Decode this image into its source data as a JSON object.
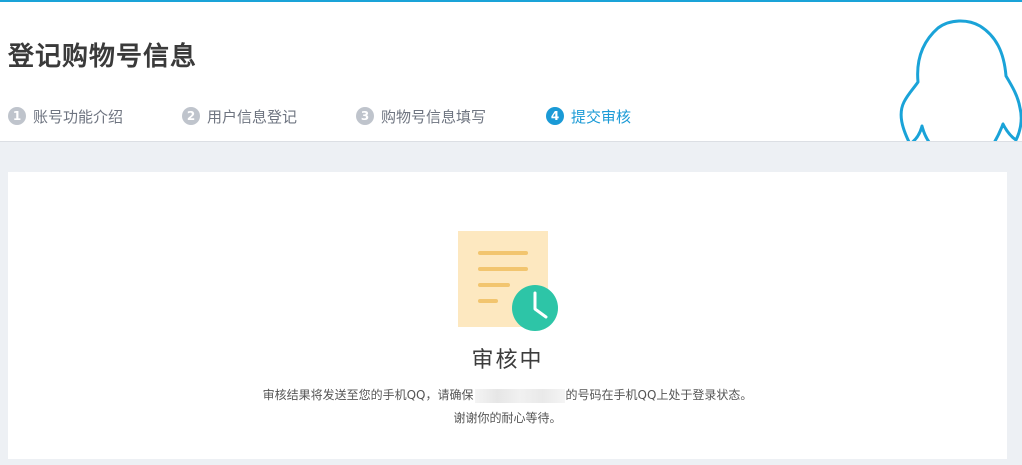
{
  "header": {
    "title": "登记购物号信息",
    "steps": [
      {
        "num": "1",
        "label": "账号功能介绍",
        "state": "done"
      },
      {
        "num": "2",
        "label": "用户信息登记",
        "state": "done"
      },
      {
        "num": "3",
        "label": "购物号信息填写",
        "state": "done"
      },
      {
        "num": "4",
        "label": "提交审核",
        "state": "active"
      }
    ]
  },
  "status": {
    "title": "审核中",
    "notice_before": "审核结果将发送至您的手机QQ，请确保",
    "notice_after": "的号码在手机QQ上处于登录状态。",
    "thanks": "谢谢你的耐心等待。"
  },
  "icons": {
    "mascot": "qq-penguin-icon",
    "document": "document-icon",
    "clock": "clock-icon"
  },
  "colors": {
    "accent": "#1a9ad6",
    "inactive_step": "#bfc4cc",
    "document": "#fde8c0",
    "clock": "#2dc5a7"
  }
}
